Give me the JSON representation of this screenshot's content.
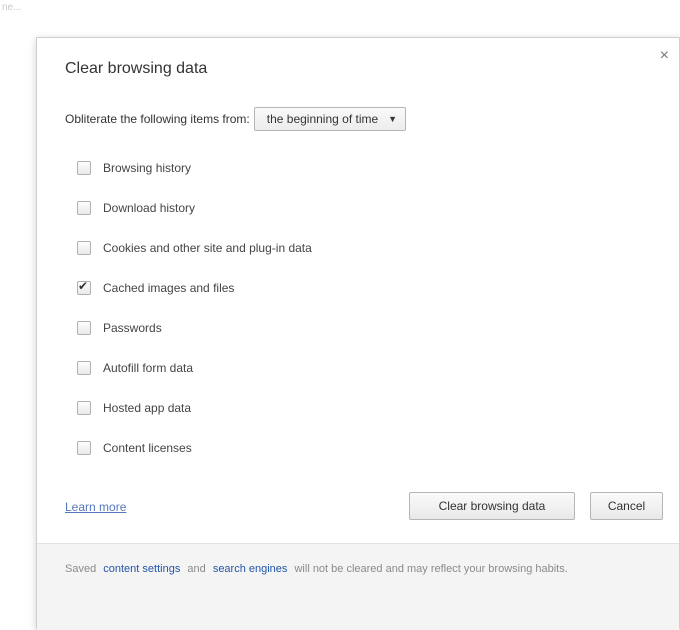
{
  "page": {
    "top_left_text": "ne..."
  },
  "dialog": {
    "title": "Clear browsing data",
    "close_glyph": "×",
    "obliterate_label": "Obliterate the following items from:",
    "time_range": {
      "selected": "the beginning of time",
      "arrow_glyph": "▼"
    },
    "options": [
      {
        "label": "Browsing history",
        "checked": false
      },
      {
        "label": "Download history",
        "checked": false
      },
      {
        "label": "Cookies and other site and plug-in data",
        "checked": false
      },
      {
        "label": "Cached images and files",
        "checked": true
      },
      {
        "label": "Passwords",
        "checked": false
      },
      {
        "label": "Autofill form data",
        "checked": false
      },
      {
        "label": "Hosted app data",
        "checked": false
      },
      {
        "label": "Content licenses",
        "checked": false
      }
    ],
    "learn_more": "Learn more",
    "clear_button": "Clear browsing data",
    "cancel_button": "Cancel"
  },
  "footer": {
    "prefix": "Saved",
    "link1": "content settings",
    "middle": "and",
    "link2": "search engines",
    "suffix": "will not be cleared and may reflect your browsing habits."
  }
}
